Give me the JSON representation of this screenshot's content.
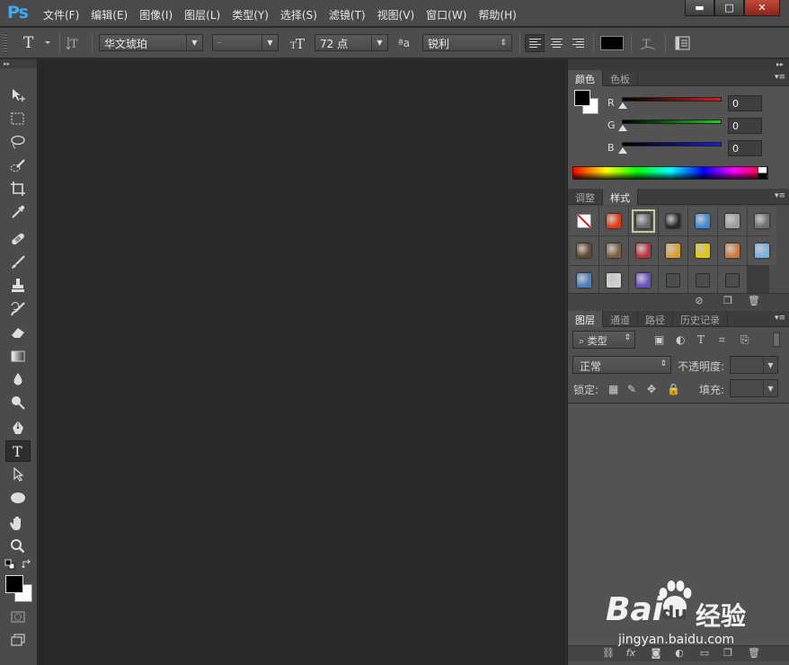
{
  "app": {
    "logo": "Ps"
  },
  "menu": [
    {
      "label": "文件(F)"
    },
    {
      "label": "编辑(E)"
    },
    {
      "label": "图像(I)"
    },
    {
      "label": "图层(L)"
    },
    {
      "label": "类型(Y)"
    },
    {
      "label": "选择(S)"
    },
    {
      "label": "滤镜(T)"
    },
    {
      "label": "视图(V)"
    },
    {
      "label": "窗口(W)"
    },
    {
      "label": "帮助(H)"
    }
  ],
  "window_controls": {
    "minimize": "▬",
    "restore": "□",
    "close": "✕"
  },
  "options_bar": {
    "font_family": "华文琥珀",
    "font_style": "-",
    "font_size": "72 点",
    "antialias": "锐利",
    "aa_glyph": "ªa",
    "text_color": "#000000"
  },
  "color_panel": {
    "tabs": [
      "颜色",
      "色板"
    ],
    "channels": [
      {
        "label": "R",
        "value": "0",
        "color": "#e01b1b"
      },
      {
        "label": "G",
        "value": "0",
        "color": "#1bd11b"
      },
      {
        "label": "B",
        "value": "0",
        "color": "#1b1be0"
      }
    ],
    "foreground": "#000000",
    "background": "#ffffff"
  },
  "styles_panel": {
    "tabs": [
      "调整",
      "样式"
    ],
    "swatches": [
      "none",
      "#e43a12",
      "#6a6a6a",
      "#2a2a2a",
      "#3d8ad6",
      "#9e9e9e",
      "#707070",
      "#5e4a2e",
      "#7a6040",
      "#c0303a",
      "#d7a030",
      "#e0c800",
      "#d07840",
      "#7ab0e0",
      "#4a80c0",
      "#d0d0d0",
      "#6b4fc8",
      "#4d4d4d",
      "#4d4d4d",
      "#4d4d4d"
    ]
  },
  "layers_panel": {
    "tabs": [
      "图层",
      "通道",
      "路径",
      "历史记录"
    ],
    "filter_label": "类型",
    "blend_mode": "正常",
    "opacity_label": "不透明度:",
    "lock_label": "锁定:",
    "fill_label": "填充:"
  },
  "watermark": {
    "brand": "Bai",
    "brand2": "du",
    "suffix": "经验",
    "url": "jingyan.baidu.com"
  }
}
